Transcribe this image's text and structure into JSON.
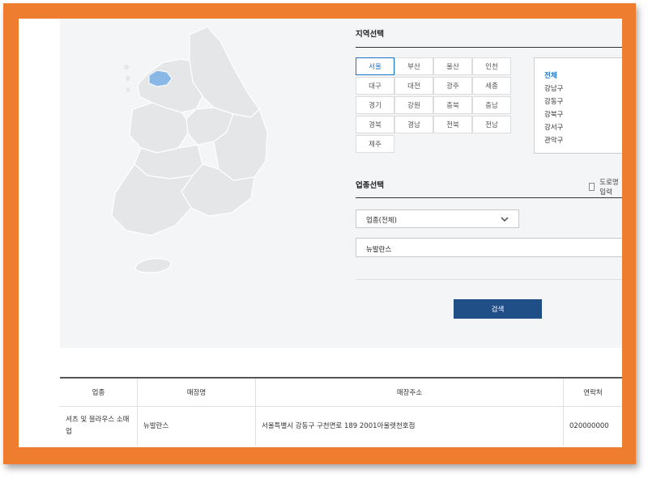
{
  "region_section": {
    "title": "지역선택",
    "regions": [
      "서울",
      "부산",
      "울산",
      "인천",
      "대구",
      "대전",
      "광주",
      "세종",
      "경기",
      "강원",
      "충북",
      "충남",
      "경북",
      "경남",
      "전북",
      "전남",
      "제주"
    ],
    "selected_region": "서울",
    "districts": [
      "전체",
      "강남구",
      "강동구",
      "강북구",
      "강서구",
      "관악구"
    ],
    "selected_district": "전체"
  },
  "business_section": {
    "title": "업종선택",
    "road_name_label": "도로명 입력",
    "category_select": "업종(전체)",
    "keyword_value": "뉴발란스",
    "search_button": "검색"
  },
  "results_table": {
    "headers": [
      "업종",
      "매장명",
      "매장주소",
      "연락처"
    ],
    "rows": [
      [
        "셔츠 및 블라우스 소매업",
        "뉴발란스",
        "서울특별시 강동구 구천면로 189 2001아울렛천호점",
        "020000000"
      ]
    ]
  },
  "colors": {
    "frame": "#ee7d30",
    "accent": "#1e73c6",
    "search_button": "#1f4f86",
    "map_land": "#e5e6e8",
    "map_selected": "#8ab8e6"
  }
}
